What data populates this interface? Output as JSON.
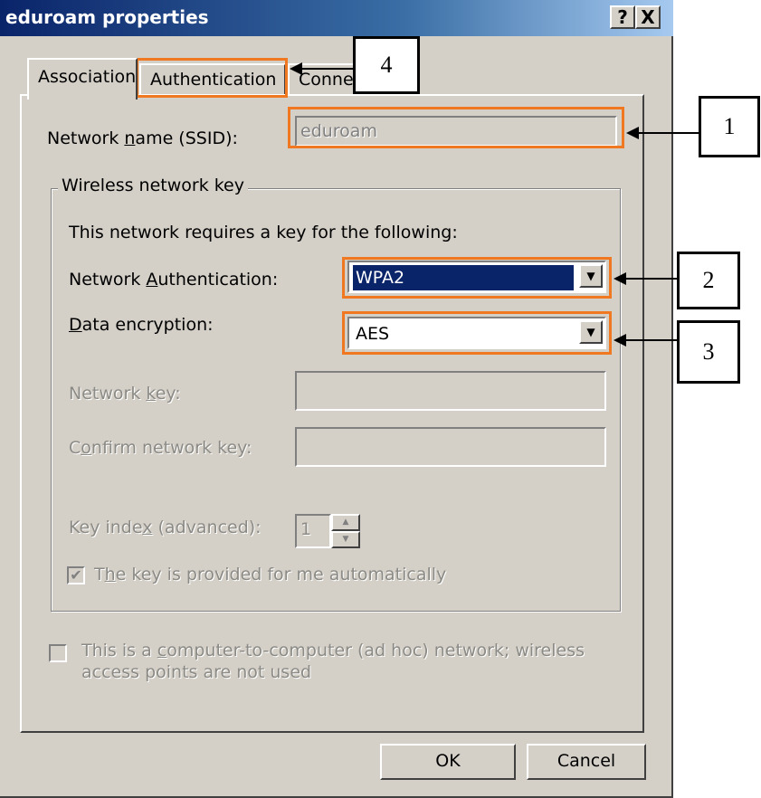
{
  "window": {
    "title": "eduroam properties",
    "help_label": "?",
    "close_label": "X"
  },
  "tabs": [
    {
      "label": "Association",
      "active": true
    },
    {
      "label": "Authentication",
      "active": false
    },
    {
      "label": "Conne",
      "active": false
    }
  ],
  "association": {
    "ssid_label_pre": "Network ",
    "ssid_label_ul": "n",
    "ssid_label_post": "ame (SSID):",
    "ssid_value": "eduroam",
    "group_title": "Wireless network key",
    "requires_text": "This network requires a key for the following:",
    "auth_label_pre": "Network ",
    "auth_label_ul": "A",
    "auth_label_post": "uthentication:",
    "auth_value": "WPA2",
    "enc_label_ul": "D",
    "enc_label_post": "ata encryption:",
    "enc_value": "AES",
    "netkey_label_pre": "Network ",
    "netkey_label_ul": "k",
    "netkey_label_post": "ey:",
    "confirm_label_pre": "C",
    "confirm_label_ul": "o",
    "confirm_label_post": "nfirm network key:",
    "keyindex_label_pre": "Key inde",
    "keyindex_label_ul": "x",
    "keyindex_label_post": " (advanced):",
    "keyindex_value": "1",
    "auto_key_pre": "T",
    "auto_key_ul": "h",
    "auto_key_post": "e key is provided for me automatically",
    "auto_key_checked": true,
    "adhoc_line1_pre": "This is a ",
    "adhoc_line1_ul": "c",
    "adhoc_line1_post": "omputer-to-computer (ad hoc) network; wireless",
    "adhoc_line2": "access points are not used",
    "adhoc_checked": false
  },
  "buttons": {
    "ok": "OK",
    "cancel": "Cancel"
  },
  "callouts": [
    "1",
    "2",
    "3",
    "4"
  ],
  "colors": {
    "highlight": "#f07820",
    "selection": "#0a246a",
    "dialog_bg": "#d4d0c8"
  }
}
